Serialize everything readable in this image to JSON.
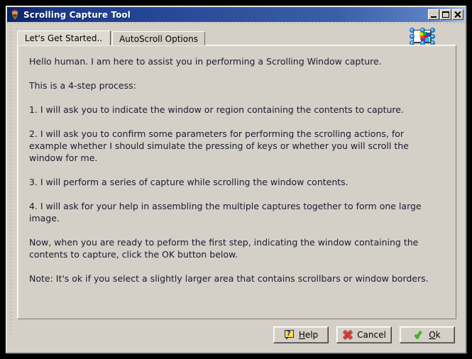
{
  "window": {
    "title": "Scrolling Capture Tool",
    "app_icon": "spartan-helmet-icon",
    "controls": {
      "minimize": "Minimize",
      "maximize": "Maximize",
      "close": "Close"
    }
  },
  "tabs": [
    {
      "label": "Let's Get Started..",
      "active": true
    },
    {
      "label": "AutoScroll Options",
      "active": false
    }
  ],
  "preview": {
    "name": "capture-thumbnail-preview",
    "selected": true,
    "handle_color": "#2f9fe8"
  },
  "content": {
    "paragraphs": [
      "Hello human.  I am here to assist you in performing a Scrolling Window capture.",
      "This is a 4-step process:",
      "1. I will ask you to indicate the window or region containing the contents to capture.",
      "2. I will ask you to confirm some parameters for performing the scrolling actions, for example whether I should simulate the pressing of keys or whether you will scroll the window for me.",
      "3. I will perform a series of capture while scrolling the window contents.",
      "4. I will ask for your help in assembling the multiple captures together to form one large image.",
      "Now, when you are ready to peform the first step, indicating the window containing the contents to capture, click the OK button below.",
      "Note: It's ok if you select a slightly larger area that contains scrollbars or window borders."
    ]
  },
  "buttons": {
    "help": {
      "label": "Help",
      "accel": "H",
      "icon": "help-question-icon"
    },
    "cancel": {
      "label": "Cancel",
      "accel": "",
      "icon": "red-x-icon"
    },
    "ok": {
      "label": "Ok",
      "accel": "O",
      "icon": "green-check-icon"
    }
  },
  "colors": {
    "titlebar_start": "#0a246a",
    "titlebar_end": "#a6c0e6",
    "face": "#d4d0c8",
    "panel": "#d4d0c8",
    "text": "#1a1a2e",
    "accent_ok": "#3fb424",
    "accent_cancel": "#d13c34",
    "accent_help": "#ffe14d"
  }
}
